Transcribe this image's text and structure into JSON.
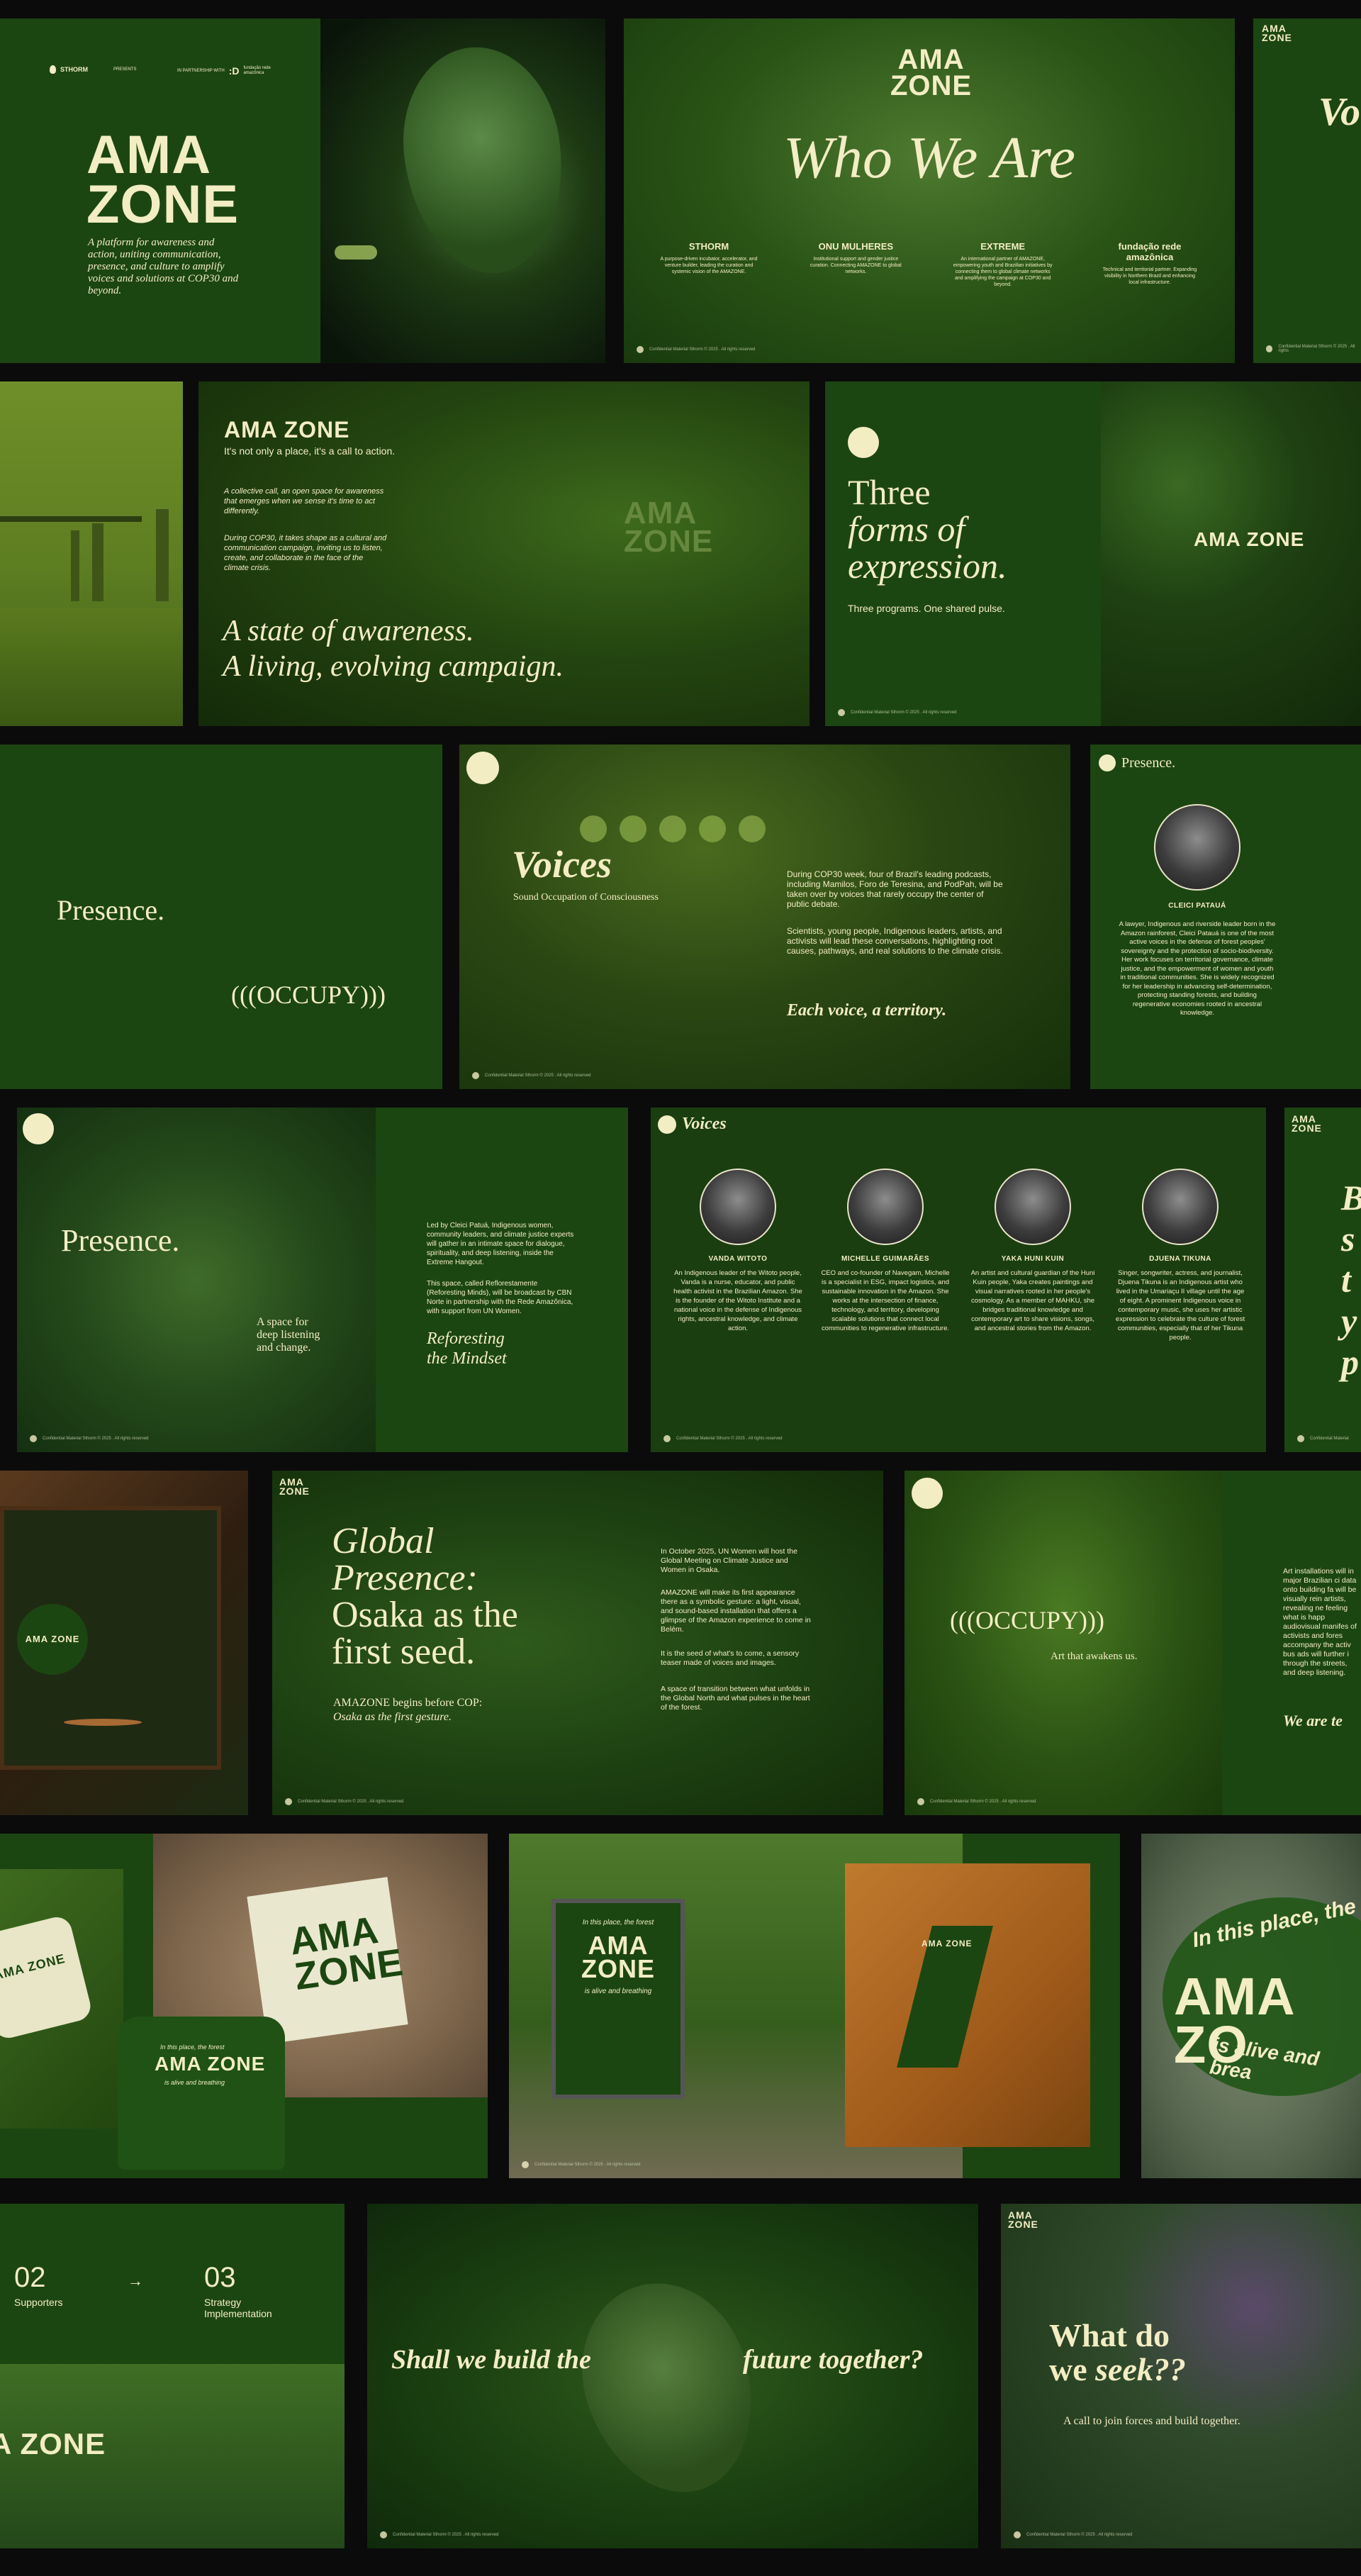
{
  "row1": {
    "c1": {
      "brand": "STHORM",
      "presents": "PRESENTS",
      "partnership": "IN PARTNERSHIP WITH",
      "partner": "fundação rede amazônica",
      "logo_line1": "AMA",
      "logo_line2": "ZONE",
      "tagline": "A platform for awareness and action, uniting communication, presence, and culture to amplify voices and solutions at COP30 and beyond."
    },
    "c3": {
      "logo_line1": "AMA",
      "logo_line2": "ZONE",
      "title": "Who We  Are",
      "partners": [
        {
          "name": "STHORM",
          "desc": "A purpose-driven incubator, accelerator, and venture builder, leading the curation and systemic vision of the AMAZONE."
        },
        {
          "name": "ONU MULHERES",
          "desc": "Institutional support and gender justice curation. Connecting AMAZONE to global networks."
        },
        {
          "name": "EXTREME",
          "desc": "An international partner of AMAZONE, empowering youth and Brazilian initiatives by connecting them to global climate networks and amplifying the campaign at COP30 and beyond."
        },
        {
          "name": "fundação rede amazônica",
          "desc": "Technical and territorial partner. Expanding visibility in Northern Brazil and enhancing local infrastructure."
        }
      ],
      "footer": "Confidential Material    Sthorm © 2025 . All rights reserved"
    },
    "c4": {
      "logo_line1": "AMA",
      "logo_line2": "ZONE",
      "partial": "Vo",
      "footer": "Confidential Material    Sthorm © 2025 . All rights"
    }
  },
  "row2": {
    "c2": {
      "title": "AMA ZONE",
      "subtitle": "It's not only a place, it's a call to action.",
      "para1": "A collective call, an open space for awareness that emerges when we sense it's time to act differently.",
      "para2": "During COP30, it takes shape as a cultural and communication campaign, inviting us to listen, create, and collaborate in the face of the climate crisis.",
      "statement1": "A state of awareness.",
      "statement2": "A living, evolving campaign.",
      "screen_line1": "AMA",
      "screen_line2": "ZONE"
    },
    "c3": {
      "title1": "Three",
      "title2": "forms of",
      "title3": "expression.",
      "subtitle": "Three programs. One shared pulse.",
      "overlay": "AMA ZONE",
      "footer": "Confidential Material    Sthorm © 2025 . All rights reserved"
    }
  },
  "row3": {
    "c1": {
      "presence": "Presence.",
      "occupy": "(((OCCUPY)))"
    },
    "c2": {
      "title": "Voices",
      "subtitle": "Sound Occupation of Consciousness",
      "para1": "During COP30 week, four of Brazil's leading podcasts, including Mamilos, Foro de Teresina, and PodPah, will be taken over by voices that rarely occupy the center of public debate.",
      "para2": "Scientists, young people, Indigenous leaders, artists, and activists will lead these conversations, highlighting root causes, pathways, and real solutions to the climate crisis.",
      "closing": "Each voice, a territory.",
      "footer": "Confidential Material    Sthorm © 2025 . All rights reserved"
    },
    "c3": {
      "title": "Presence.",
      "name": "CLEICI PATAUÁ",
      "bio": "A lawyer, Indigenous and riverside leader born in the Amazon rainforest, Cleici Patauá is one of the most active voices in the defense of forest peoples' sovereignty and the protection of socio-biodiversity. Her work focuses on territorial governance, climate justice, and the empowerment of women and youth in traditional communities. She is widely recognized for her leadership in advancing self-determination, protecting standing forests, and building regenerative economies rooted in ancestral knowledge."
    }
  },
  "row4": {
    "c1": {
      "title": "Presence.",
      "space1": "A space for",
      "space2": "deep listening",
      "space3": "and change.",
      "para1": "Led by Cleici Patuá, Indigenous women, community leaders, and climate justice experts will gather in an intimate space for dialogue, spirituality, and deep listening, inside the Extreme Hangout.",
      "para2": "This space, called Reflorestamente (Reforesting Minds), will be broadcast by CBN Norte in partnership with the Rede Amazônica, with support from UN Women.",
      "closing1": "Reforesting",
      "closing2": "the Mindset",
      "footer": "Confidential Material    Sthorm © 2025 . All rights reserved"
    },
    "c2": {
      "title": "Voices",
      "people": [
        {
          "name": "VANDA WITOTO",
          "bio": "An Indigenous leader of the Witoto people, Vanda is a nurse, educator, and public health activist in the Brazilian Amazon. She is the founder of the Witoto Institute and a national voice in the defense of Indigenous rights, ancestral knowledge, and climate action."
        },
        {
          "name": "MICHELLE GUIMARÃES",
          "bio": "CEO and co-founder of Navegam, Michelle is a specialist in ESG, impact logistics, and sustainable innovation in the Amazon. She works at the intersection of finance, technology, and territory, developing scalable solutions that connect local communities to regenerative infrastructure."
        },
        {
          "name": "YAKA HUNI KUIN",
          "bio": "An artist and cultural guardian of the Huni Kuin people, Yaka creates paintings and visual narratives rooted in her people's cosmology. As a member of MAHKU, she bridges traditional knowledge and contemporary art to share visions, songs, and ancestral stories from the Amazon."
        },
        {
          "name": "DJUENA TIKUNA",
          "bio": "Singer, songwriter, actress, and journalist, Djuena Tikuna is an Indigenous artist who lived in the Umariaçu II village until the age of eight. A prominent Indigenous voice in contemporary music, she uses her artistic expression to celebrate the culture of forest communities, especially that of her Tikuna people."
        }
      ],
      "footer": "Confidential Material    Sthorm © 2025 . All rights reserved"
    },
    "c3": {
      "logo_line1": "AMA",
      "logo_line2": "ZONE",
      "partial": [
        "B",
        "s",
        "t",
        "y",
        "p"
      ],
      "footer": "Confidential Material"
    }
  },
  "row5": {
    "c1": {
      "sign": "AMA ZONE"
    },
    "c2": {
      "logo_line1": "AMA",
      "logo_line2": "ZONE",
      "title1": "Global",
      "title2": "Presence:",
      "title3": "Osaka as the",
      "title4": "first seed.",
      "sub1": "AMAZONE begins before COP:",
      "sub2": "Osaka as the first gesture.",
      "para1": "In October 2025, UN Women will host the Global Meeting on Climate Justice and Women in Osaka.",
      "para2": "AMAZONE will make its first appearance there as a symbolic gesture: a light, visual, and sound-based installation that offers a glimpse of the Amazon experience to come in Belém.",
      "para3": "It is the seed of what's to come, a sensory teaser made of voices and images.",
      "para4": "A space of transition between what unfolds in the Global North and what pulses in the heart of the forest.",
      "footer": "Confidential Material    Sthorm © 2025 . All rights reserved"
    },
    "c3": {
      "occupy": "(((OCCUPY)))",
      "sub": "Art that awakens us.",
      "para": "Art installations will in major Brazilian ci data onto building fa will be visually rein artists, revealing ne feeling what is happ audiovisual manifes of activists and fores accompany the activ bus ads will further i through the streets, and deep listening.",
      "closing": "We are te",
      "footer": "Confidential Material    Sthorm © 2025 . All rights reserved"
    }
  },
  "row6": {
    "c1": {
      "pillow": "AMA ZONE"
    },
    "c2": {
      "bag_line1": "AMA",
      "bag_line2": "ZONE",
      "shirt_top": "In this place, the forest",
      "shirt": "AMA ZONE",
      "shirt_bottom": "is alive and breathing"
    },
    "c3": {
      "sign_top": "In this place, the forest",
      "sign_line1": "AMA",
      "sign_line2": "ZONE",
      "sign_bottom": "is alive and breathing",
      "chair": "AMA ZONE",
      "footer": "Confidential Material    Sthorm © 2025 . All rights reserved"
    },
    "c4": {
      "arc_top": "In this place, the",
      "wordmark": "AMA ZO",
      "arc_bottom": "is alive and brea"
    }
  },
  "row7": {
    "c1": {
      "steps": [
        {
          "num": "02",
          "label": "Supporters"
        },
        {
          "num": "03",
          "label": "Strategy Implementation"
        }
      ],
      "logo": "A ZONE"
    },
    "c2": {
      "left": "Shall we build the",
      "right": "future together?",
      "footer": "Confidential Material    Sthorm © 2025 . All rights reserved"
    },
    "c3": {
      "logo_line1": "AMA",
      "logo_line2": "ZONE",
      "title1": "What do",
      "title2": "we ",
      "title_em": "seek??",
      "sub": "A call to join forces and build together.",
      "footer": "Confidential Material    Sthorm © 2025 . All rights reserved"
    }
  },
  "colors": {
    "cream": "#f3edc4",
    "green": "#1c4611",
    "deep": "#0f2a0b",
    "bg": "#0b0b0b"
  }
}
